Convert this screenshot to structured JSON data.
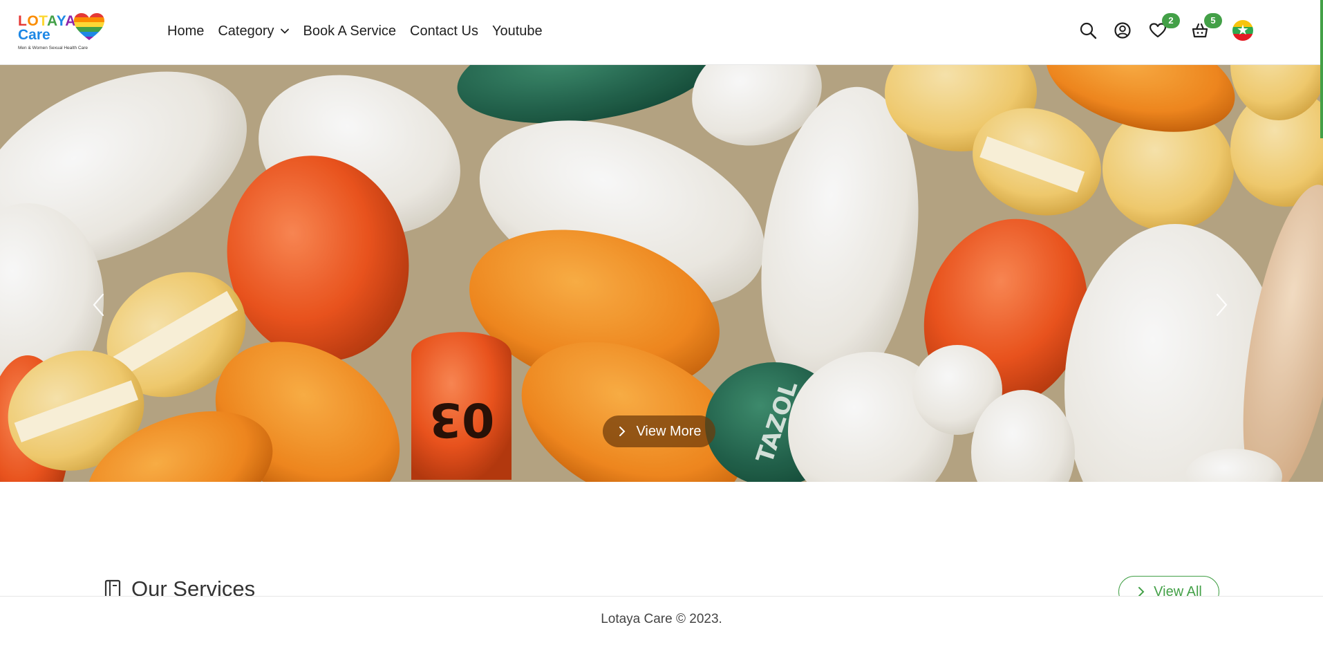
{
  "logo": {
    "word": [
      "L",
      "O",
      "T",
      "A",
      "Y",
      "A"
    ],
    "word2": "Care",
    "tagline": "Men & Women Sexual Health Care"
  },
  "nav": {
    "items": [
      "Home",
      "Category",
      "Book A Service",
      "Contact Us",
      "Youtube"
    ]
  },
  "header_icons": {
    "wishlist_count": "2",
    "cart_count": "5",
    "icons": [
      "search-icon",
      "user-icon",
      "heart-icon",
      "basket-icon",
      "myanmar-flag-icon"
    ]
  },
  "hero": {
    "view_more_label": "View More",
    "pill_imprint_1": "03",
    "pill_imprint_2": "TAZOL"
  },
  "services": {
    "title": "Our Services",
    "view_all_label": "View All"
  },
  "footer": {
    "text": "Lotaya Care © 2023."
  },
  "colors": {
    "accent": "#43a047",
    "badge": "#43a047",
    "view_more_bg": "#6e3a0a"
  }
}
